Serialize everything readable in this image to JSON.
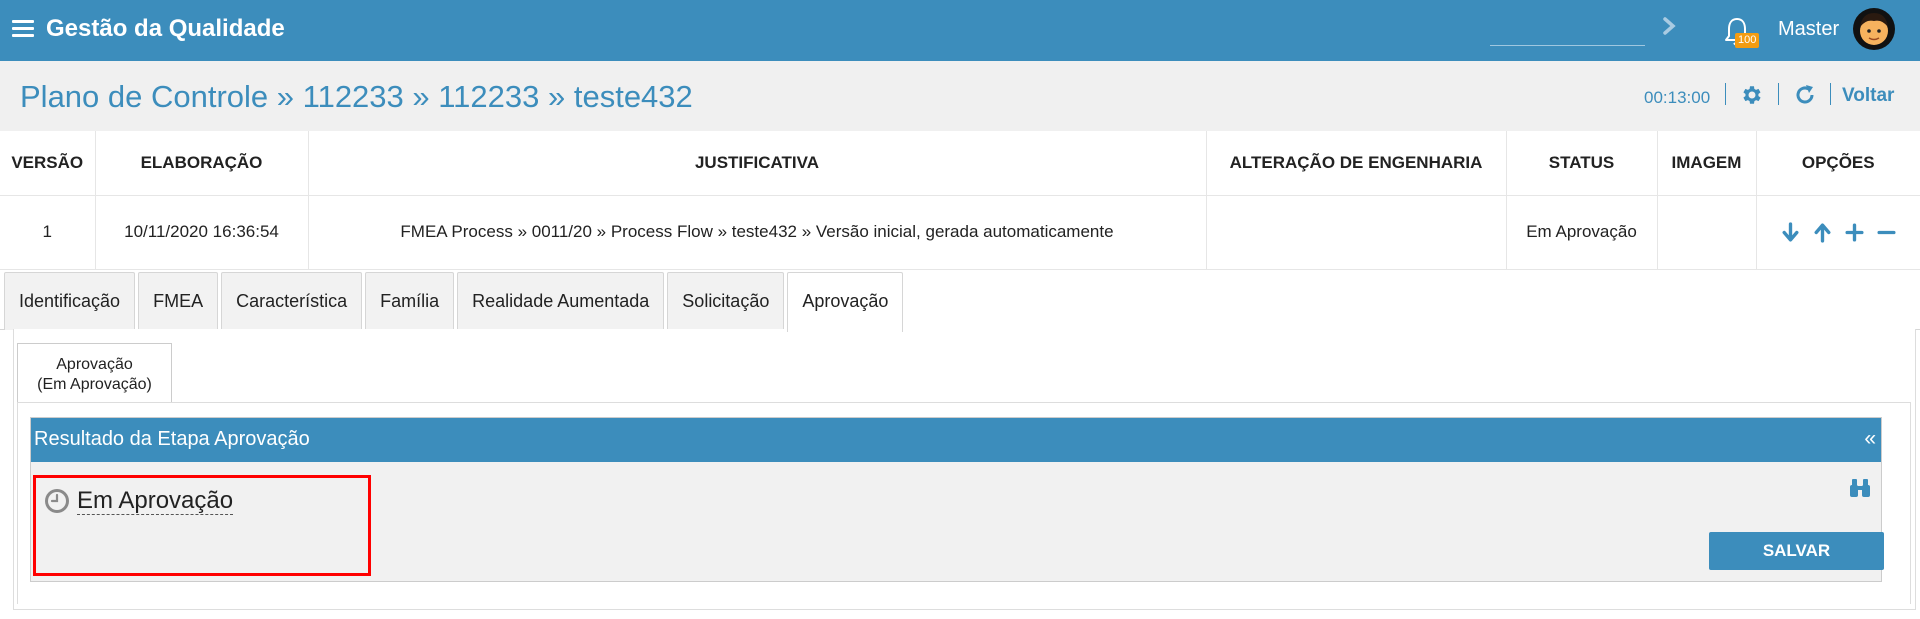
{
  "app": {
    "title": "Gestão da Qualidade"
  },
  "topbar": {
    "search_value": "",
    "notification_count": "100",
    "user_name": "Master"
  },
  "header": {
    "breadcrumb": "Plano de Controle » 112233 » 112233 » teste432",
    "timer": "00:13:00",
    "back_label": "Voltar"
  },
  "versions_table": {
    "columns": [
      "VERSÃO",
      "ELABORAÇÃO",
      "JUSTIFICATIVA",
      "ALTERAÇÃO DE ENGENHARIA",
      "STATUS",
      "IMAGEM",
      "OPÇÕES"
    ],
    "rows": [
      {
        "version": "1",
        "elaboration": "10/11/2020 16:36:54",
        "justification": "FMEA Process » 0011/20 » Process Flow » teste432 » Versão inicial, gerada automaticamente",
        "engineering_change": "",
        "status": "Em Aprovação",
        "image": ""
      }
    ],
    "option_icons": [
      "arrow-down-icon",
      "arrow-up-icon",
      "plus-icon",
      "minus-icon"
    ]
  },
  "tabs": [
    {
      "label": "Identificação"
    },
    {
      "label": "FMEA"
    },
    {
      "label": "Característica"
    },
    {
      "label": "Família"
    },
    {
      "label": "Realidade Aumentada"
    },
    {
      "label": "Solicitação"
    },
    {
      "label": "Aprovação",
      "active": true
    }
  ],
  "approval": {
    "subtab_line1": "Aprovação",
    "subtab_line2": "(Em Aprovação)",
    "box_title": "Resultado da Etapa Aprovação",
    "collapse_glyph": "«",
    "status_text": "Em Aprovação",
    "save_label": "SALVAR"
  },
  "colors": {
    "primary": "#3c8dbc",
    "badge": "#f39c12",
    "highlight": "#ff0000"
  }
}
